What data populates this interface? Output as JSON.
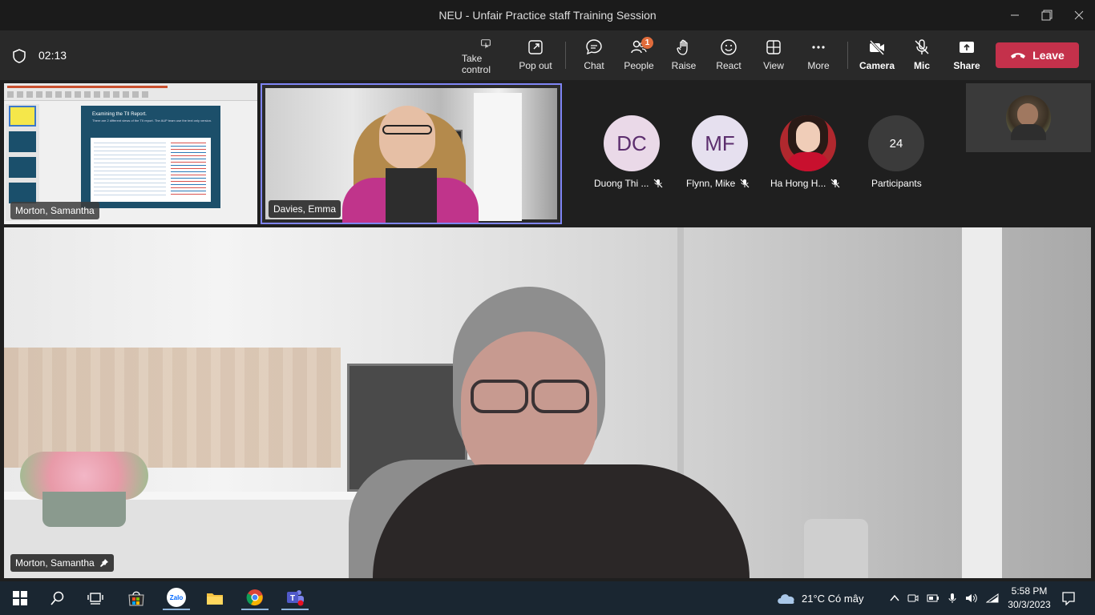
{
  "window": {
    "title": "NEU - Unfair Practice staff Training Session"
  },
  "meeting": {
    "timer": "02:13"
  },
  "toolbar": {
    "take_control": "Take control",
    "pop_out": "Pop out",
    "chat": "Chat",
    "people": "People",
    "people_badge": "1",
    "raise": "Raise",
    "react": "React",
    "view": "View",
    "more": "More",
    "camera": "Camera",
    "mic": "Mic",
    "share": "Share",
    "leave": "Leave"
  },
  "slide": {
    "title": "Examining the TII Report.",
    "body": "There are 2 different views of the TII report. The AUP team use the text only version."
  },
  "tiles": {
    "screen_share_name": "Morton, Samantha",
    "video_name": "Davies, Emma",
    "main_name": "Morton, Samantha"
  },
  "participants": [
    {
      "initials": "DC",
      "name": "Duong Thi ...",
      "color": "#ead9e8"
    },
    {
      "initials": "MF",
      "name": "Flynn, Mike",
      "color": "#e6e0ef"
    },
    {
      "initials": "",
      "name": "Ha Hong H...",
      "color": "#b0282e"
    }
  ],
  "participant_count": {
    "count": "24",
    "label": "Participants"
  },
  "taskbar": {
    "weather": "21°C  Có mây",
    "time": "5:58 PM",
    "date": "30/3/2023",
    "zalo": "Zalo"
  }
}
